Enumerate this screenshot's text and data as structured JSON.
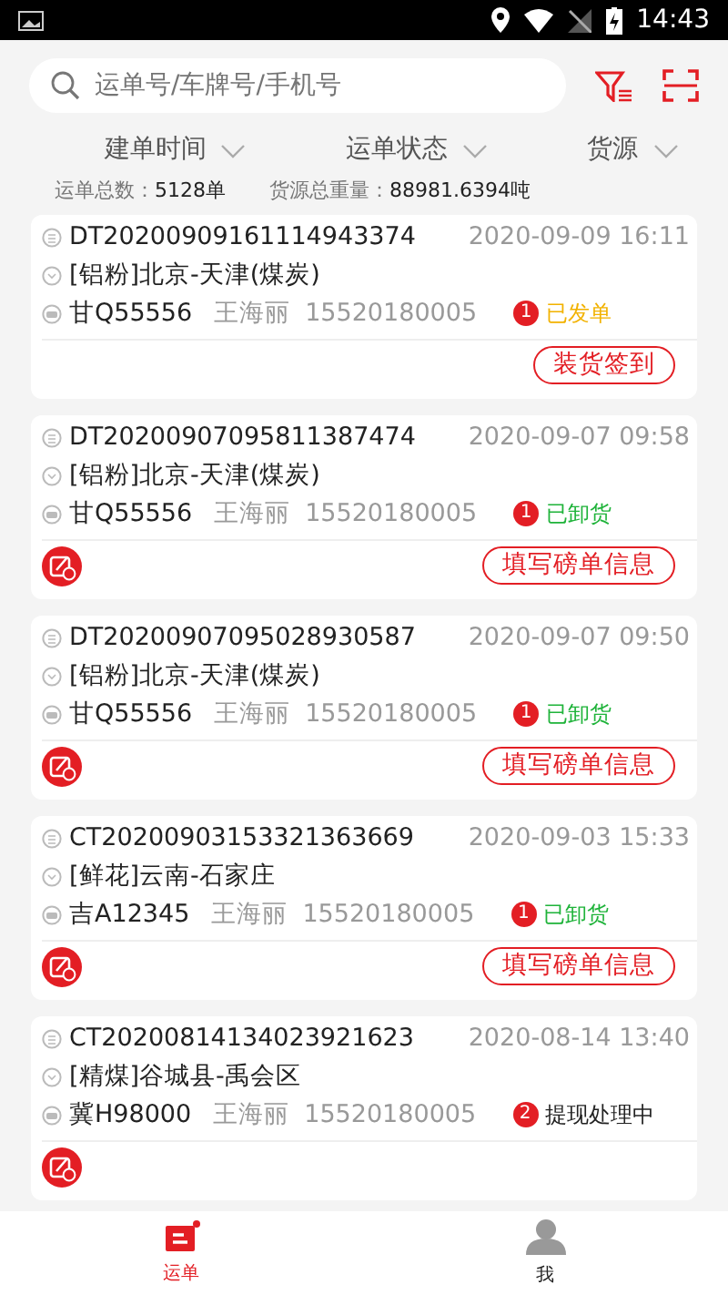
{
  "status_bar": {
    "time": "14:43"
  },
  "search": {
    "placeholder": "运单号/车牌号/手机号"
  },
  "filters": [
    {
      "label": "建单时间"
    },
    {
      "label": "运单状态"
    },
    {
      "label": "货源"
    }
  ],
  "summary": {
    "count_label": "运单总数：",
    "count": "5128单",
    "weight_label": "货源总重量：",
    "weight": "88981.6394吨"
  },
  "orders": [
    {
      "id": "DT20200909161114943374",
      "time": "2020-09-09 16:11",
      "route": "[铝粉]北京-天津(煤炭)",
      "plate": "甘Q55556",
      "driver": "王海丽",
      "phone": "15520180005",
      "badge": "1",
      "status": "已发单",
      "color": "#f2b200",
      "edit_icon": false,
      "action": "装货签到"
    },
    {
      "id": "DT20200907095811387474",
      "time": "2020-09-07 09:58",
      "route": "[铝粉]北京-天津(煤炭)",
      "plate": "甘Q55556",
      "driver": "王海丽",
      "phone": "15520180005",
      "badge": "1",
      "status": "已卸货",
      "color": "#1fb33a",
      "edit_icon": true,
      "action": "填写磅单信息"
    },
    {
      "id": "DT20200907095028930587",
      "time": "2020-09-07 09:50",
      "route": "[铝粉]北京-天津(煤炭)",
      "plate": "甘Q55556",
      "driver": "王海丽",
      "phone": "15520180005",
      "badge": "1",
      "status": "已卸货",
      "color": "#1fb33a",
      "edit_icon": true,
      "action": "填写磅单信息"
    },
    {
      "id": "CT20200903153321363669",
      "time": "2020-09-03 15:33",
      "route": "[鲜花]云南-石家庄",
      "plate": "吉A12345",
      "driver": "王海丽",
      "phone": "15520180005",
      "badge": "1",
      "status": "已卸货",
      "color": "#1fb33a",
      "edit_icon": true,
      "action": "填写磅单信息"
    },
    {
      "id": "CT20200814134023921623",
      "time": "2020-08-14 13:40",
      "route": "[精煤]谷城县-禹会区",
      "plate": "冀H98000",
      "driver": "王海丽",
      "phone": "15520180005",
      "badge": "2",
      "status": "提现处理中",
      "color": "#222222",
      "edit_icon": true
    }
  ],
  "tabs": [
    {
      "label": "运单",
      "selected": true
    },
    {
      "label": "我",
      "selected": false
    }
  ]
}
